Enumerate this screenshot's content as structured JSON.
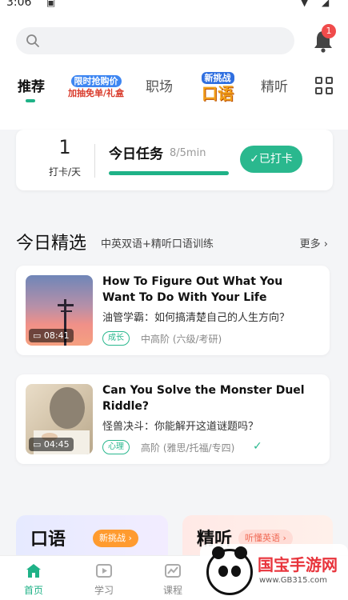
{
  "status_bar": {
    "time": "3:06"
  },
  "search": {
    "placeholder": ""
  },
  "notifications": {
    "count": "1"
  },
  "tabs": {
    "recommend": "推荐",
    "promo1_line1": "限时抢购价",
    "promo1_line2": "加抽免单/礼盒",
    "workplace": "职场",
    "promo2_line1": "新挑战",
    "promo2_line2": "口语",
    "listening": "精听"
  },
  "task": {
    "count": "1",
    "unit": "打卡/天",
    "title": "今日任务",
    "progress_text": "8/5min",
    "progress": 1.0,
    "button": "✓已打卡"
  },
  "section": {
    "title": "今日精选",
    "subtitle": "中英双语+精听口语训练",
    "more": "更多 ›"
  },
  "videos": [
    {
      "title": "How To Figure Out What You Want To Do With Your Life",
      "subtitle": "油管学霸：如何搞清楚自己的人生方向？",
      "duration": "08:41",
      "tag": "成长",
      "level": "中高阶 (六级/考研)"
    },
    {
      "title": "Can You Solve the Monster Duel Riddle?",
      "subtitle": "怪兽决斗：你能解开这道谜题吗？",
      "duration": "04:45",
      "tag": "心理",
      "level": "高阶 (雅思/托福/专四)"
    }
  ],
  "bottom_cards": {
    "speaking": "口语",
    "speaking_badge": "新挑战 ›",
    "listening": "精听",
    "listening_badge": "听懂英语 ›"
  },
  "nav": {
    "home": "首页",
    "study": "学习",
    "courses": "课程"
  },
  "watermark": {
    "text": "国宝手游网",
    "url": "www.GB315.com"
  },
  "colors": {
    "accent": "#1fb287",
    "badge": "#f04b4b"
  }
}
